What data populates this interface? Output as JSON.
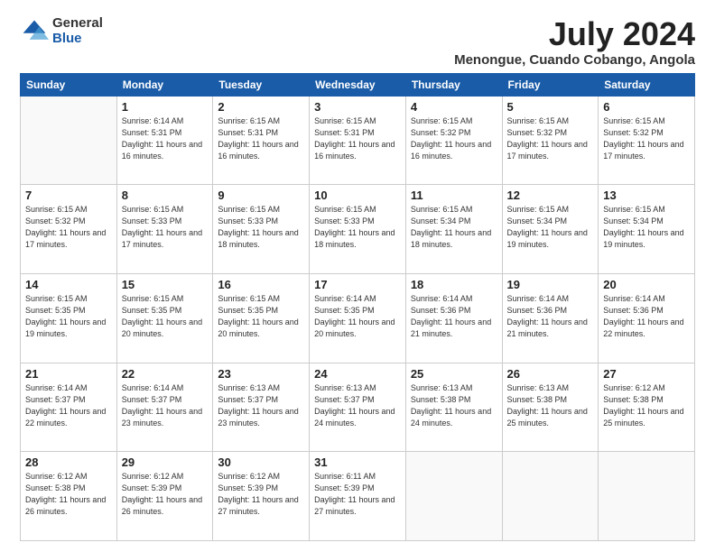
{
  "logo": {
    "general": "General",
    "blue": "Blue"
  },
  "title": "July 2024",
  "location": "Menongue, Cuando Cobango, Angola",
  "days_of_week": [
    "Sunday",
    "Monday",
    "Tuesday",
    "Wednesday",
    "Thursday",
    "Friday",
    "Saturday"
  ],
  "weeks": [
    [
      {
        "day": "",
        "sunrise": "",
        "sunset": "",
        "daylight": ""
      },
      {
        "day": "1",
        "sunrise": "Sunrise: 6:14 AM",
        "sunset": "Sunset: 5:31 PM",
        "daylight": "Daylight: 11 hours and 16 minutes."
      },
      {
        "day": "2",
        "sunrise": "Sunrise: 6:15 AM",
        "sunset": "Sunset: 5:31 PM",
        "daylight": "Daylight: 11 hours and 16 minutes."
      },
      {
        "day": "3",
        "sunrise": "Sunrise: 6:15 AM",
        "sunset": "Sunset: 5:31 PM",
        "daylight": "Daylight: 11 hours and 16 minutes."
      },
      {
        "day": "4",
        "sunrise": "Sunrise: 6:15 AM",
        "sunset": "Sunset: 5:32 PM",
        "daylight": "Daylight: 11 hours and 16 minutes."
      },
      {
        "day": "5",
        "sunrise": "Sunrise: 6:15 AM",
        "sunset": "Sunset: 5:32 PM",
        "daylight": "Daylight: 11 hours and 17 minutes."
      },
      {
        "day": "6",
        "sunrise": "Sunrise: 6:15 AM",
        "sunset": "Sunset: 5:32 PM",
        "daylight": "Daylight: 11 hours and 17 minutes."
      }
    ],
    [
      {
        "day": "7",
        "sunrise": "Sunrise: 6:15 AM",
        "sunset": "Sunset: 5:32 PM",
        "daylight": "Daylight: 11 hours and 17 minutes."
      },
      {
        "day": "8",
        "sunrise": "Sunrise: 6:15 AM",
        "sunset": "Sunset: 5:33 PM",
        "daylight": "Daylight: 11 hours and 17 minutes."
      },
      {
        "day": "9",
        "sunrise": "Sunrise: 6:15 AM",
        "sunset": "Sunset: 5:33 PM",
        "daylight": "Daylight: 11 hours and 18 minutes."
      },
      {
        "day": "10",
        "sunrise": "Sunrise: 6:15 AM",
        "sunset": "Sunset: 5:33 PM",
        "daylight": "Daylight: 11 hours and 18 minutes."
      },
      {
        "day": "11",
        "sunrise": "Sunrise: 6:15 AM",
        "sunset": "Sunset: 5:34 PM",
        "daylight": "Daylight: 11 hours and 18 minutes."
      },
      {
        "day": "12",
        "sunrise": "Sunrise: 6:15 AM",
        "sunset": "Sunset: 5:34 PM",
        "daylight": "Daylight: 11 hours and 19 minutes."
      },
      {
        "day": "13",
        "sunrise": "Sunrise: 6:15 AM",
        "sunset": "Sunset: 5:34 PM",
        "daylight": "Daylight: 11 hours and 19 minutes."
      }
    ],
    [
      {
        "day": "14",
        "sunrise": "Sunrise: 6:15 AM",
        "sunset": "Sunset: 5:35 PM",
        "daylight": "Daylight: 11 hours and 19 minutes."
      },
      {
        "day": "15",
        "sunrise": "Sunrise: 6:15 AM",
        "sunset": "Sunset: 5:35 PM",
        "daylight": "Daylight: 11 hours and 20 minutes."
      },
      {
        "day": "16",
        "sunrise": "Sunrise: 6:15 AM",
        "sunset": "Sunset: 5:35 PM",
        "daylight": "Daylight: 11 hours and 20 minutes."
      },
      {
        "day": "17",
        "sunrise": "Sunrise: 6:14 AM",
        "sunset": "Sunset: 5:35 PM",
        "daylight": "Daylight: 11 hours and 20 minutes."
      },
      {
        "day": "18",
        "sunrise": "Sunrise: 6:14 AM",
        "sunset": "Sunset: 5:36 PM",
        "daylight": "Daylight: 11 hours and 21 minutes."
      },
      {
        "day": "19",
        "sunrise": "Sunrise: 6:14 AM",
        "sunset": "Sunset: 5:36 PM",
        "daylight": "Daylight: 11 hours and 21 minutes."
      },
      {
        "day": "20",
        "sunrise": "Sunrise: 6:14 AM",
        "sunset": "Sunset: 5:36 PM",
        "daylight": "Daylight: 11 hours and 22 minutes."
      }
    ],
    [
      {
        "day": "21",
        "sunrise": "Sunrise: 6:14 AM",
        "sunset": "Sunset: 5:37 PM",
        "daylight": "Daylight: 11 hours and 22 minutes."
      },
      {
        "day": "22",
        "sunrise": "Sunrise: 6:14 AM",
        "sunset": "Sunset: 5:37 PM",
        "daylight": "Daylight: 11 hours and 23 minutes."
      },
      {
        "day": "23",
        "sunrise": "Sunrise: 6:13 AM",
        "sunset": "Sunset: 5:37 PM",
        "daylight": "Daylight: 11 hours and 23 minutes."
      },
      {
        "day": "24",
        "sunrise": "Sunrise: 6:13 AM",
        "sunset": "Sunset: 5:37 PM",
        "daylight": "Daylight: 11 hours and 24 minutes."
      },
      {
        "day": "25",
        "sunrise": "Sunrise: 6:13 AM",
        "sunset": "Sunset: 5:38 PM",
        "daylight": "Daylight: 11 hours and 24 minutes."
      },
      {
        "day": "26",
        "sunrise": "Sunrise: 6:13 AM",
        "sunset": "Sunset: 5:38 PM",
        "daylight": "Daylight: 11 hours and 25 minutes."
      },
      {
        "day": "27",
        "sunrise": "Sunrise: 6:12 AM",
        "sunset": "Sunset: 5:38 PM",
        "daylight": "Daylight: 11 hours and 25 minutes."
      }
    ],
    [
      {
        "day": "28",
        "sunrise": "Sunrise: 6:12 AM",
        "sunset": "Sunset: 5:38 PM",
        "daylight": "Daylight: 11 hours and 26 minutes."
      },
      {
        "day": "29",
        "sunrise": "Sunrise: 6:12 AM",
        "sunset": "Sunset: 5:39 PM",
        "daylight": "Daylight: 11 hours and 26 minutes."
      },
      {
        "day": "30",
        "sunrise": "Sunrise: 6:12 AM",
        "sunset": "Sunset: 5:39 PM",
        "daylight": "Daylight: 11 hours and 27 minutes."
      },
      {
        "day": "31",
        "sunrise": "Sunrise: 6:11 AM",
        "sunset": "Sunset: 5:39 PM",
        "daylight": "Daylight: 11 hours and 27 minutes."
      },
      {
        "day": "",
        "sunrise": "",
        "sunset": "",
        "daylight": ""
      },
      {
        "day": "",
        "sunrise": "",
        "sunset": "",
        "daylight": ""
      },
      {
        "day": "",
        "sunrise": "",
        "sunset": "",
        "daylight": ""
      }
    ]
  ]
}
